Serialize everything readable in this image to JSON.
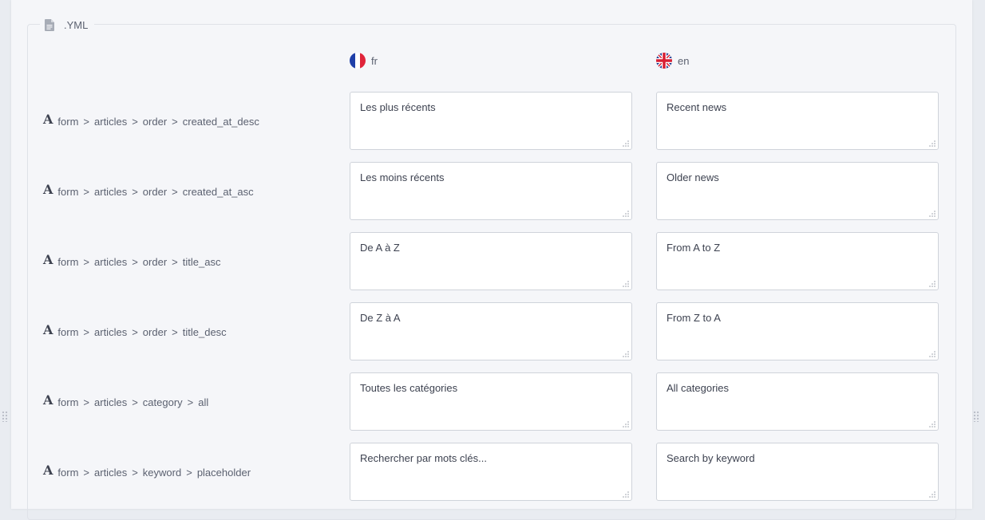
{
  "section": {
    "title": ".YML",
    "icon": "document-icon"
  },
  "languages": [
    {
      "code": "fr",
      "icon": "flag-france-icon"
    },
    {
      "code": "en",
      "icon": "flag-uk-icon"
    }
  ],
  "rows": [
    {
      "path": [
        "form",
        "articles",
        "order",
        "created_at_desc"
      ],
      "fr": "Les plus récents",
      "en": "Recent news"
    },
    {
      "path": [
        "form",
        "articles",
        "order",
        "created_at_asc"
      ],
      "fr": "Les moins récents",
      "en": "Older news"
    },
    {
      "path": [
        "form",
        "articles",
        "order",
        "title_asc"
      ],
      "fr": "De A à Z",
      "en": "From A to Z"
    },
    {
      "path": [
        "form",
        "articles",
        "order",
        "title_desc"
      ],
      "fr": "De Z à A",
      "en": "From Z to A"
    },
    {
      "path": [
        "form",
        "articles",
        "category",
        "all"
      ],
      "fr": "Toutes les catégories",
      "en": "All categories"
    },
    {
      "path": [
        "form",
        "articles",
        "keyword",
        "placeholder"
      ],
      "fr": "Rechercher par mots clés...",
      "en": "Search by keyword"
    }
  ],
  "colors": {
    "panel": "#f5f6f9",
    "border": "#cfd3da",
    "text": "#5b6170"
  }
}
